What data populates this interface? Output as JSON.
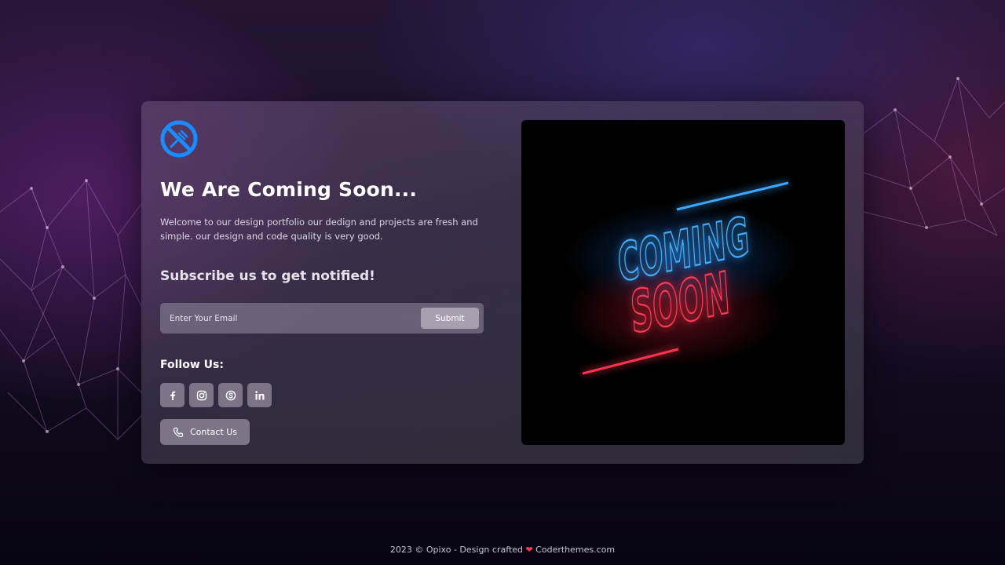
{
  "brand": {
    "logo_icon": "utensils-ban-logo-icon",
    "accent_color": "#1a8cff"
  },
  "hero": {
    "title": "We Are Coming Soon...",
    "description": "Welcome to our design portfolio our dedign and projects are fresh and simple. our design and code quality is very good."
  },
  "subscribe": {
    "title": "Subscribe us to get notified!",
    "email_placeholder": "Enter Your Email",
    "email_value": "",
    "submit_label": "Submit"
  },
  "social": {
    "title": "Follow Us:",
    "items": [
      {
        "icon": "facebook-icon"
      },
      {
        "icon": "instagram-icon"
      },
      {
        "icon": "skype-icon"
      },
      {
        "icon": "linkedin-icon"
      }
    ]
  },
  "contact": {
    "label": "Contact Us",
    "icon": "phone-icon"
  },
  "media": {
    "line1": "COMING",
    "line2": "SOON",
    "blue_color": "#1e90ff",
    "red_color": "#ff1e3c"
  },
  "footer": {
    "year_copy": "2023 © Opixo - Design crafted",
    "heart": "❤",
    "credit": "Coderthemes.com"
  }
}
